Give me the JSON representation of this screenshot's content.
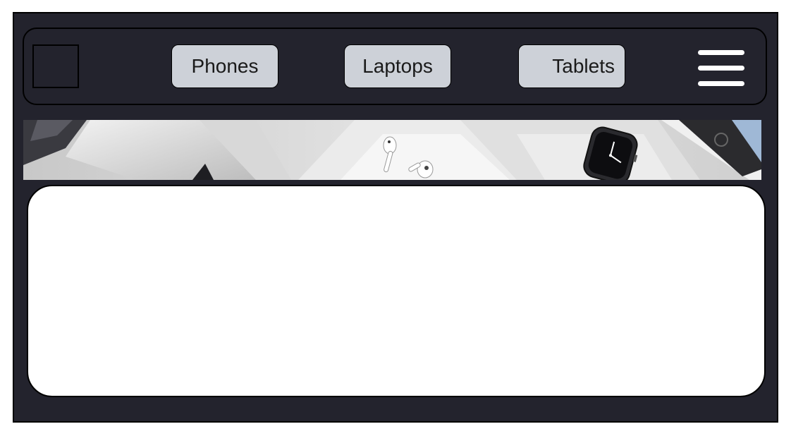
{
  "nav": {
    "items": [
      {
        "label": "Phones"
      },
      {
        "label": "Laptops"
      },
      {
        "label": "Tablets"
      }
    ],
    "logo_icon": "logo-placeholder-icon",
    "menu_icon": "hamburger-menu-icon"
  },
  "banner": {
    "image": "device-products-banner"
  },
  "colors": {
    "frame_background": "#23232d",
    "button_background": "#cdd1d8",
    "card_background": "#ffffff"
  }
}
